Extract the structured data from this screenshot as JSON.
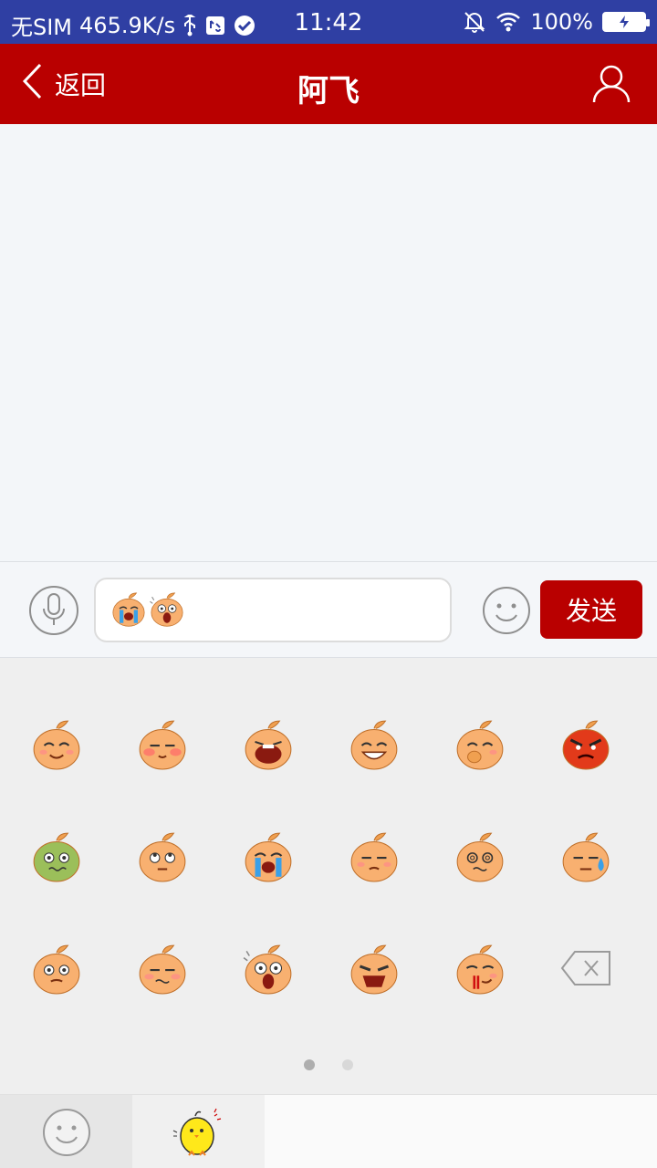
{
  "status_bar": {
    "carrier": "无SIM",
    "speed": "465.9K/s",
    "time": "11:42",
    "battery": "100%",
    "icons": [
      "usb-icon",
      "storage-icon",
      "check-circle-icon",
      "mute-bell-icon",
      "wifi-icon",
      "battery-charging-icon"
    ]
  },
  "header": {
    "back_label": "返回",
    "title": "阿飞",
    "icons": [
      "back-chevron-icon",
      "profile-icon"
    ],
    "color": "#b90000"
  },
  "input_bar": {
    "emoji_in_input": [
      "crying",
      "shocked"
    ],
    "send_label": "发送",
    "icons": [
      "microphone-icon",
      "smiley-icon"
    ]
  },
  "emoji_panel": {
    "emojis": [
      "smile",
      "shy",
      "wail",
      "grin",
      "giggle",
      "angry",
      "sick",
      "eye-roll",
      "crying",
      "unamused",
      "dizzy",
      "sweat",
      "surprised",
      "embarrassed",
      "shocked",
      "yell",
      "nosebleed"
    ],
    "delete_icon": "backspace-icon",
    "page_count": 2,
    "current_page": 1
  },
  "bottom_tabs": {
    "tabs": [
      "smiley-tab",
      "chick-tab"
    ],
    "selected": 1
  }
}
